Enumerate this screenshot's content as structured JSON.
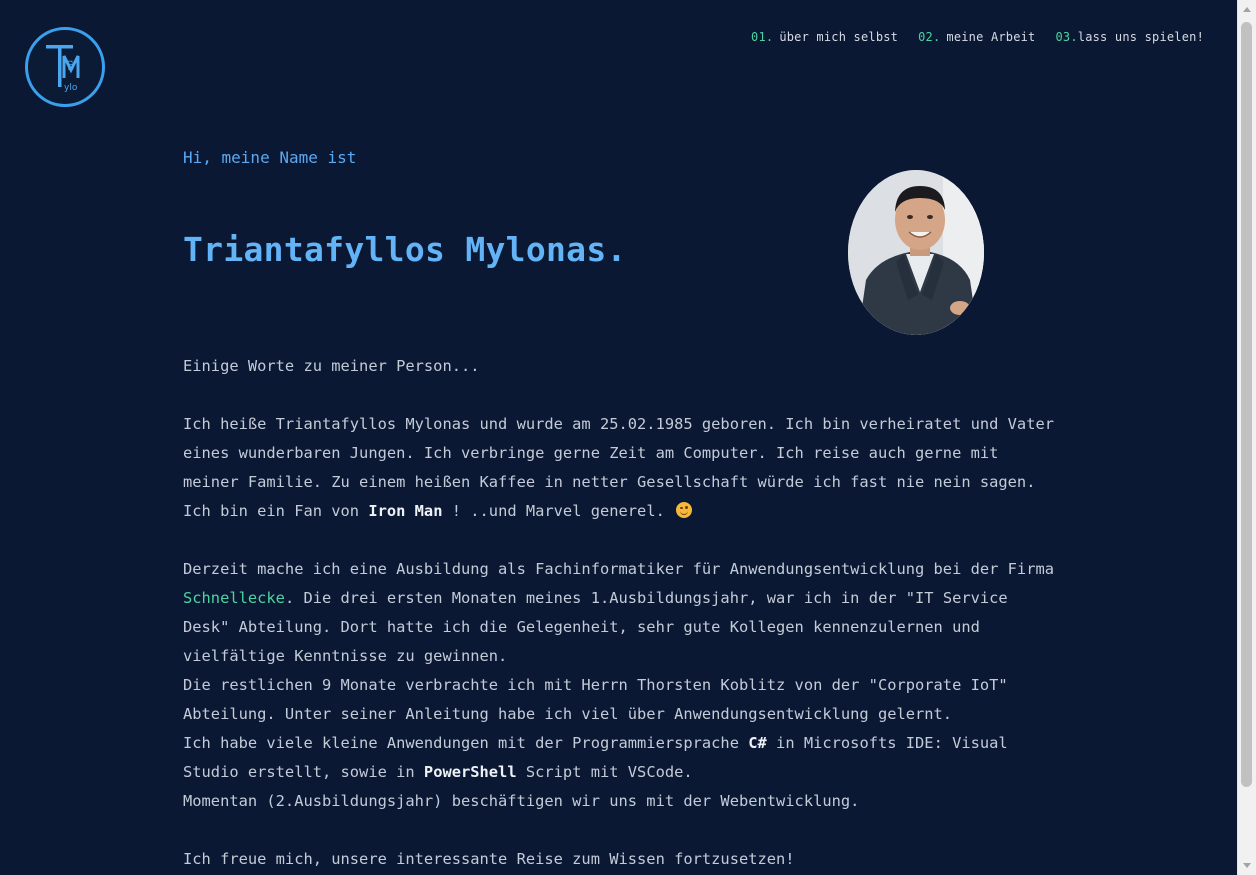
{
  "logo": {
    "letters_big": "TM",
    "letters_small_1": "ria",
    "letters_small_2": "ylo",
    "icon": "tm-logo-icon"
  },
  "nav": [
    {
      "num": "01.",
      "label": "über mich selbst"
    },
    {
      "num": "02.",
      "label": "meine Arbeit"
    },
    {
      "num": "03.",
      "label": "lass uns spielen!"
    }
  ],
  "hero": {
    "greeting": "Hi, meine Name ist",
    "name": "Triantafyllos Mylonas."
  },
  "about": {
    "intro": "Einige Worte zu meiner Person...",
    "p1_text": "Ich heiße Triantafyllos Mylonas und wurde am 25.02.1985 geboren. Ich bin verheiratet und Vater eines wunderbaren Jungen. Ich verbringe gerne Zeit am Computer. Ich reise auch gerne mit meiner Familie. Zu einem heißen Kaffee in netter Gesellschaft würde ich fast nie nein sagen. Ich bin ein Fan von ",
    "p1_bold": "Iron Man",
    "p1_tail": " ! ..und Marvel generel. ",
    "p1_emoji": "wink-emoji",
    "p2_a": "Derzeit mache ich eine Ausbildung als Fachinformatiker für Anwendungsentwicklung bei der Firma ",
    "p2_company": "Schnellecke",
    "p2_b": ". Die drei ersten Monaten meines 1.Ausbildungsjahr, war ich in der \"IT Service Desk\" Abteilung. Dort hatte ich die Gelegenheit, sehr gute Kollegen kennenzulernen und vielfältige Kenntnisse zu gewinnen.",
    "p2_line2": "Die restlichen 9 Monate verbrachte ich mit Herrn Thorsten Koblitz von der \"Corporate IoT\" Abteilung. Unter seiner Anleitung habe ich viel über Anwendungsentwicklung gelernt.",
    "p2_line3_a": "Ich habe viele kleine Anwendungen mit der Programmiersprache ",
    "p2_line3_bold1": "C#",
    "p2_line3_b": " in Microsofts IDE: Visual Studio erstellt, sowie in ",
    "p2_line3_bold2": "PowerShell",
    "p2_line3_c": " Script mit VSCode.",
    "p2_line4": "Momentan (2.Ausbildungsjahr) beschäftigen wir uns mit der Webentwicklung.",
    "p3": "Ich freue mich, unsere interessante Reise zum Wissen fortzusetzen!"
  },
  "colors": {
    "background": "#0b1833",
    "accent_blue": "#63b3f7",
    "accent_green": "#4dd3a0",
    "text": "#c4cbd8"
  }
}
